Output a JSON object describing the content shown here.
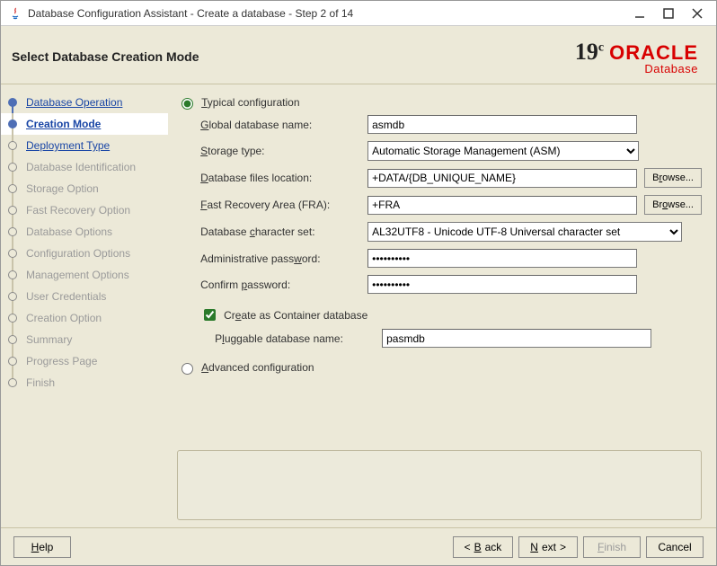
{
  "window": {
    "title": "Database Configuration Assistant - Create a database - Step 2 of 14",
    "controls": {
      "minimize": "minimize",
      "maximize": "maximize",
      "close": "close"
    }
  },
  "header": {
    "title": "Select Database Creation Mode",
    "brand_version": "19",
    "brand_superscript": "c",
    "brand_name": "ORACLE",
    "brand_sub": "Database"
  },
  "steps": [
    {
      "label": "Database Operation",
      "state": "link completed"
    },
    {
      "label": "Creation Mode",
      "state": "current"
    },
    {
      "label": "Deployment Type",
      "state": "link"
    },
    {
      "label": "Database Identification",
      "state": "disabled"
    },
    {
      "label": "Storage Option",
      "state": "disabled"
    },
    {
      "label": "Fast Recovery Option",
      "state": "disabled"
    },
    {
      "label": "Database Options",
      "state": "disabled"
    },
    {
      "label": "Configuration Options",
      "state": "disabled"
    },
    {
      "label": "Management Options",
      "state": "disabled"
    },
    {
      "label": "User Credentials",
      "state": "disabled"
    },
    {
      "label": "Creation Option",
      "state": "disabled"
    },
    {
      "label": "Summary",
      "state": "disabled"
    },
    {
      "label": "Progress Page",
      "state": "disabled"
    },
    {
      "label": "Finish",
      "state": "disabled"
    }
  ],
  "form": {
    "typical_label": "Typical configuration",
    "advanced_label": "Advanced configuration",
    "mode_selected": "typical",
    "global_db_label": "Global database name:",
    "global_db_value": "asmdb",
    "storage_label": "Storage type:",
    "storage_selected": "Automatic Storage Management (ASM)",
    "files_loc_label": "Database files location:",
    "files_loc_value": "+DATA/{DB_UNIQUE_NAME}",
    "fra_label": "Fast Recovery Area (FRA):",
    "fra_value": "+FRA",
    "charset_label": "Database character set:",
    "charset_selected": "AL32UTF8 - Unicode UTF-8 Universal character set",
    "admin_pw_label": "Administrative password:",
    "admin_pw_value": "••••••••••",
    "confirm_pw_label": "Confirm password:",
    "confirm_pw_value": "••••••••••",
    "container_label": "Create as Container database",
    "container_checked": true,
    "pdb_label": "Pluggable database name:",
    "pdb_value": "pasmdb",
    "browse_label": "Browse..."
  },
  "footer": {
    "help": "Help",
    "back": "Back",
    "next": "Next",
    "finish": "Finish",
    "cancel": "Cancel"
  }
}
